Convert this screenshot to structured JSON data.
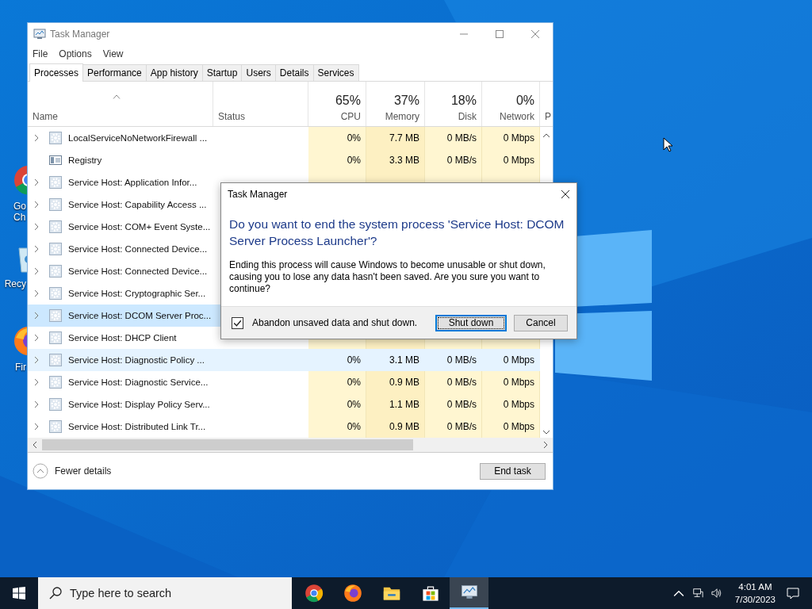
{
  "desktop_icons": [
    {
      "kind": "chrome",
      "lines": [
        "Go",
        "Ch"
      ]
    },
    {
      "kind": "bin",
      "lines": [
        "Recy"
      ]
    },
    {
      "kind": "firefox",
      "lines": [
        "Fir"
      ]
    }
  ],
  "window": {
    "title": "Task Manager",
    "menu": [
      "File",
      "Options",
      "View"
    ],
    "tabs": [
      {
        "label": "Processes",
        "selected": true
      },
      {
        "label": "Performance",
        "selected": false
      },
      {
        "label": "App history",
        "selected": false
      },
      {
        "label": "Startup",
        "selected": false
      },
      {
        "label": "Users",
        "selected": false
      },
      {
        "label": "Details",
        "selected": false
      },
      {
        "label": "Services",
        "selected": false
      }
    ],
    "columns": [
      {
        "kind": "name",
        "label": "Name"
      },
      {
        "kind": "text",
        "label": "Status"
      },
      {
        "kind": "usage",
        "percent": "65%",
        "label": "CPU"
      },
      {
        "kind": "usage",
        "percent": "37%",
        "label": "Memory"
      },
      {
        "kind": "usage",
        "percent": "18%",
        "label": "Disk"
      },
      {
        "kind": "usage",
        "percent": "0%",
        "label": "Network"
      },
      {
        "kind": "text",
        "label": "P"
      }
    ],
    "rows": [
      {
        "name": "LocalServiceNoNetworkFirewall ...",
        "kind": "service",
        "expandable": true,
        "selected": false,
        "hovered": false,
        "values": [
          "0%",
          "7.7 MB",
          "0 MB/s",
          "0 Mbps"
        ]
      },
      {
        "name": "Registry",
        "kind": "registry",
        "expandable": false,
        "selected": false,
        "hovered": false,
        "values": [
          "0%",
          "3.3 MB",
          "0 MB/s",
          "0 Mbps"
        ]
      },
      {
        "name": "Service Host: Application Infor...",
        "kind": "service",
        "expandable": true,
        "selected": false,
        "hovered": false,
        "values": []
      },
      {
        "name": "Service Host: Capability Access ...",
        "kind": "service",
        "expandable": true,
        "selected": false,
        "hovered": false,
        "values": []
      },
      {
        "name": "Service Host: COM+ Event Syste...",
        "kind": "service",
        "expandable": true,
        "selected": false,
        "hovered": false,
        "values": []
      },
      {
        "name": "Service Host: Connected Device...",
        "kind": "service",
        "expandable": true,
        "selected": false,
        "hovered": false,
        "values": []
      },
      {
        "name": "Service Host: Connected Device...",
        "kind": "service",
        "expandable": true,
        "selected": false,
        "hovered": false,
        "values": []
      },
      {
        "name": "Service Host: Cryptographic Ser...",
        "kind": "service",
        "expandable": true,
        "selected": false,
        "hovered": false,
        "values": []
      },
      {
        "name": "Service Host: DCOM Server Proc...",
        "kind": "service",
        "expandable": true,
        "selected": true,
        "hovered": false,
        "values": []
      },
      {
        "name": "Service Host: DHCP Client",
        "kind": "service",
        "expandable": true,
        "selected": false,
        "hovered": false,
        "values": []
      },
      {
        "name": "Service Host: Diagnostic Policy ...",
        "kind": "service",
        "expandable": true,
        "selected": false,
        "hovered": true,
        "values": [
          "0%",
          "3.1 MB",
          "0 MB/s",
          "0 Mbps"
        ]
      },
      {
        "name": "Service Host: Diagnostic Service...",
        "kind": "service",
        "expandable": true,
        "selected": false,
        "hovered": false,
        "values": [
          "0%",
          "0.9 MB",
          "0 MB/s",
          "0 Mbps"
        ]
      },
      {
        "name": "Service Host: Display Policy Serv...",
        "kind": "service",
        "expandable": true,
        "selected": false,
        "hovered": false,
        "values": [
          "0%",
          "1.1 MB",
          "0 MB/s",
          "0 Mbps"
        ]
      },
      {
        "name": "Service Host: Distributed Link Tr...",
        "kind": "service",
        "expandable": true,
        "selected": false,
        "hovered": false,
        "values": [
          "0%",
          "0.9 MB",
          "0 MB/s",
          "0 Mbps"
        ]
      }
    ],
    "fewer_details": "Fewer details",
    "end_task": "End task"
  },
  "dialog": {
    "title": "Task Manager",
    "heading": "Do you want to end the system process 'Service Host: DCOM Server Process Launcher'?",
    "body": "Ending this process will cause Windows to become unusable or shut down, causing you to lose any data hasn't been saved. Are you sure you want to continue?",
    "checkbox": {
      "label": "Abandon unsaved data and shut down.",
      "checked": true
    },
    "buttons": [
      {
        "label": "Shut down",
        "default": true
      },
      {
        "label": "Cancel",
        "default": false
      }
    ]
  },
  "taskbar": {
    "search_placeholder": "Type here to search",
    "apps": [
      {
        "kind": "chrome",
        "active": false
      },
      {
        "kind": "firefox",
        "active": false
      },
      {
        "kind": "folder",
        "active": false
      },
      {
        "kind": "store",
        "active": false
      },
      {
        "kind": "taskmgr",
        "active": true
      }
    ],
    "time": "4:01 AM",
    "date": "7/30/2023"
  }
}
